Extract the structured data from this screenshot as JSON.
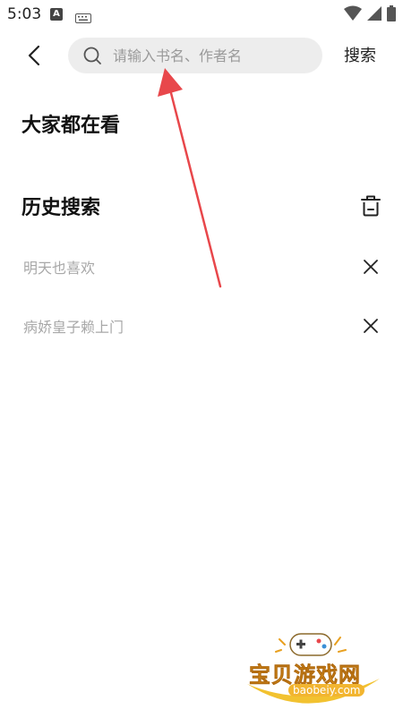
{
  "status_bar": {
    "time": "5:03",
    "icons": [
      "a-icon",
      "keyboard-icon",
      "wifi-icon",
      "signal-icon",
      "battery-icon"
    ]
  },
  "header": {
    "back_icon": "chevron-left-icon",
    "search": {
      "placeholder": "请输入书名、作者名",
      "value": ""
    },
    "search_button_label": "搜索"
  },
  "popular": {
    "title": "大家都在看"
  },
  "history": {
    "title": "历史搜索",
    "clear_icon": "trash-icon",
    "items": [
      {
        "label": "明天也喜欢"
      },
      {
        "label": "病娇皇子赖上门"
      }
    ]
  },
  "watermark": {
    "title": "宝贝游戏网",
    "url": "baobeiy.com"
  },
  "colors": {
    "search_bg": "#ededed",
    "history_text": "#a8a8a8",
    "annotation_arrow": "#e8474b"
  }
}
